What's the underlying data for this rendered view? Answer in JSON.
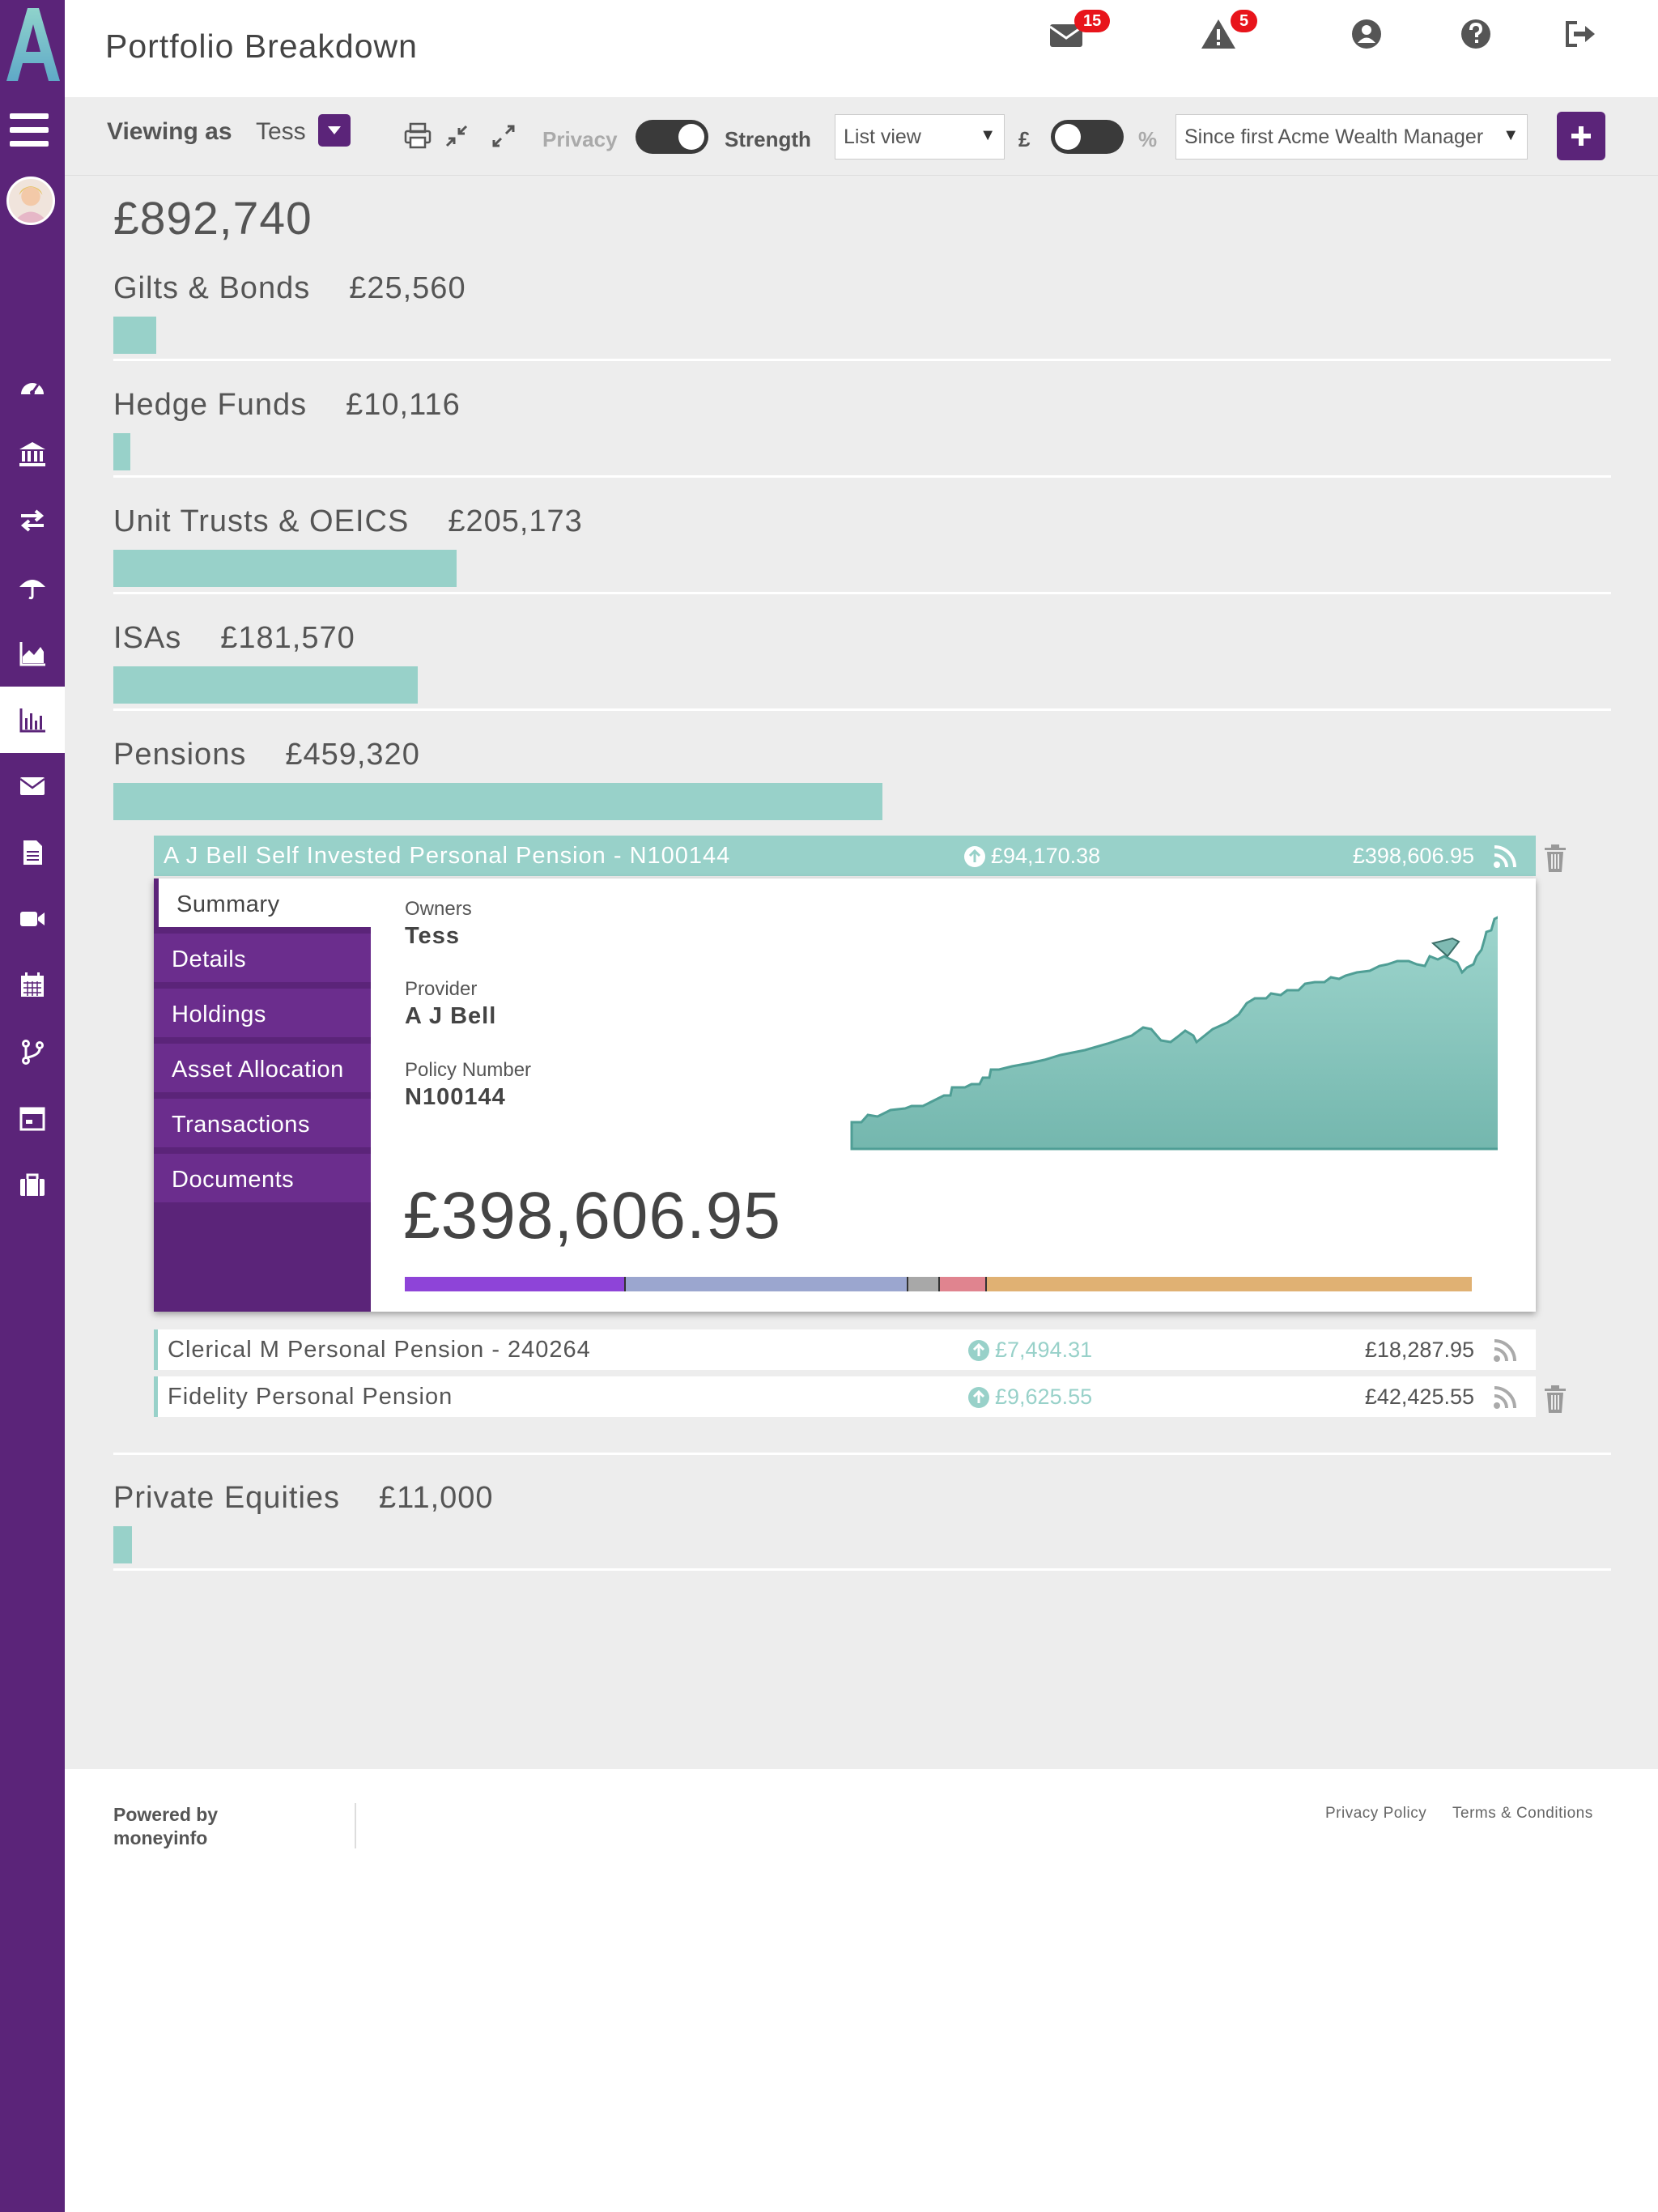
{
  "header": {
    "title": "Portfolio Breakdown",
    "messages_count": "15",
    "alerts_count": "5"
  },
  "toolbar": {
    "viewing_label": "Viewing as",
    "viewing_user": "Tess",
    "privacy_label": "Privacy",
    "privacy_on": true,
    "strength_label": "Strength",
    "view_mode": "List view",
    "currency_symbol": "£",
    "percent_symbol": "%",
    "period": "Since first Acme Wealth Manager"
  },
  "portfolio": {
    "total": "£892,740",
    "categories": [
      {
        "name": "Gilts & Bonds",
        "amount": "£25,560",
        "share": 0.0556
      },
      {
        "name": "Hedge Funds",
        "amount": "£10,116",
        "share": 0.022
      },
      {
        "name": "Unit Trusts & OEICS",
        "amount": "£205,173",
        "share": 0.4467
      },
      {
        "name": "ISAs",
        "amount": "£181,570",
        "share": 0.3953
      },
      {
        "name": "Pensions",
        "amount": "£459,320",
        "share": 1.0
      },
      {
        "name": "Private Equities",
        "amount": "£11,000",
        "share": 0.024
      }
    ]
  },
  "pensions": [
    {
      "name": "A J Bell Self Invested Personal Pension - N100144",
      "gain": "£94,170.38",
      "value": "£398,606.95"
    },
    {
      "name": "Clerical M Personal Pension - 240264",
      "gain": "£7,494.31",
      "value": "£18,287.95"
    },
    {
      "name": "Fidelity Personal Pension",
      "gain": "£9,625.55",
      "value": "£42,425.55"
    }
  ],
  "detail": {
    "tabs": [
      "Summary",
      "Details",
      "Holdings",
      "Asset Allocation",
      "Transactions",
      "Documents"
    ],
    "owners_label": "Owners",
    "owners": "Tess",
    "provider_label": "Provider",
    "provider": "A J Bell",
    "policy_label": "Policy Number",
    "policy_number": "N100144",
    "value": "£398,606.95",
    "allocation": [
      {
        "share": 0.29,
        "color": "#8e44d8"
      },
      {
        "share": 0.37,
        "color": "#9ba6cf"
      },
      {
        "share": 0.04,
        "color": "#a8a8a8"
      },
      {
        "share": 0.06,
        "color": "#e0848f"
      },
      {
        "share": 0.64,
        "color": "#e0b173"
      }
    ],
    "history_color": "#98d1c9"
  },
  "footer": {
    "powered_by": "Powered by moneyinfo",
    "privacy_policy": "Privacy Policy",
    "terms": "Terms & Conditions"
  }
}
